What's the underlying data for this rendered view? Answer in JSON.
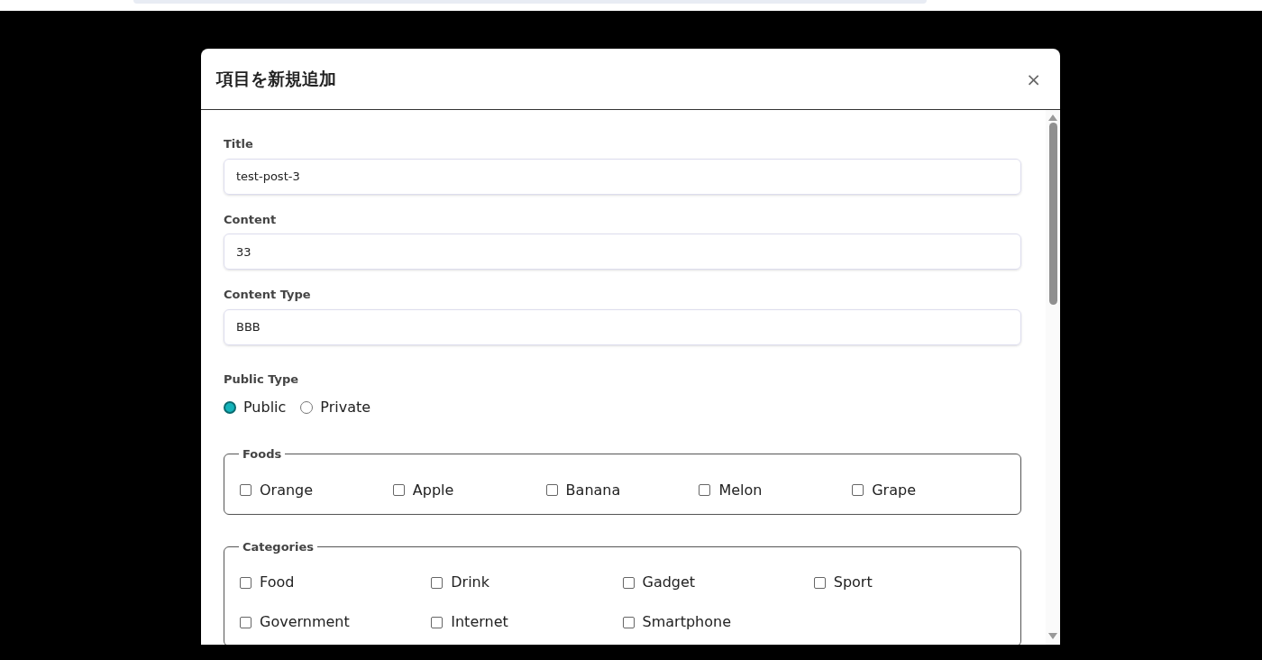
{
  "dialog": {
    "title": "項目を新規追加",
    "close": "×"
  },
  "fields": [
    {
      "label": "Title",
      "value": "test-post-3"
    },
    {
      "label": "Content",
      "value": "33"
    },
    {
      "label": "Content Type",
      "value": "BBB"
    }
  ],
  "public_type": {
    "label": "Public Type",
    "options": [
      {
        "label": "Public",
        "selected": true
      },
      {
        "label": "Private",
        "selected": false
      }
    ]
  },
  "groups": [
    {
      "legend": "Foods",
      "items": [
        {
          "label": "Orange",
          "checked": false
        },
        {
          "label": "Apple",
          "checked": false
        },
        {
          "label": "Banana",
          "checked": false
        },
        {
          "label": "Melon",
          "checked": false
        },
        {
          "label": "Grape",
          "checked": false
        }
      ]
    },
    {
      "legend": "Categories",
      "items": [
        {
          "label": "Food",
          "checked": false
        },
        {
          "label": "Drink",
          "checked": false
        },
        {
          "label": "Gadget",
          "checked": false
        },
        {
          "label": "Sport",
          "checked": false
        },
        {
          "label": "Government",
          "checked": false
        },
        {
          "label": "Internet",
          "checked": false
        },
        {
          "label": "Smartphone",
          "checked": false
        }
      ]
    }
  ]
}
